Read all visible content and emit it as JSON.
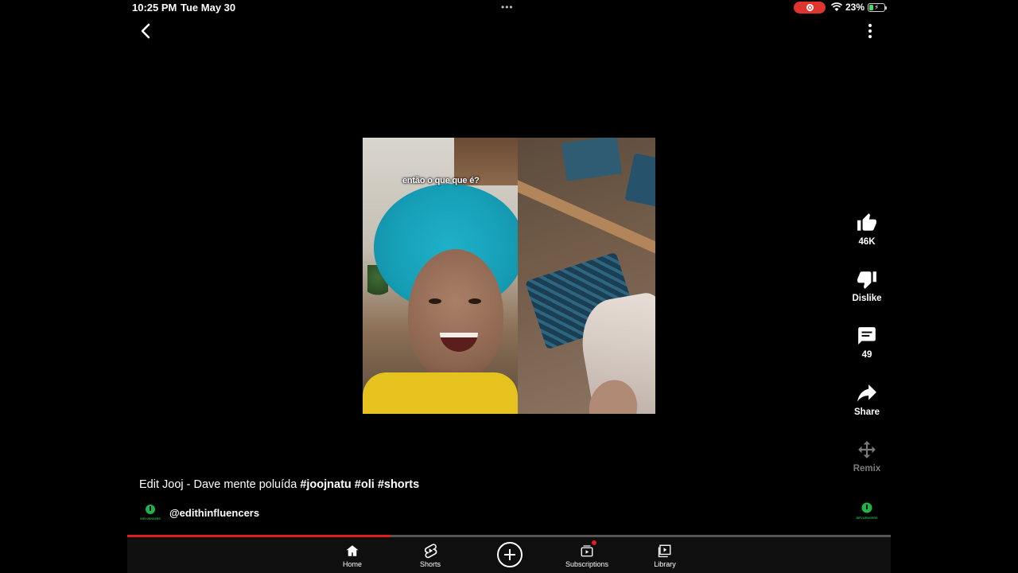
{
  "status_bar": {
    "time": "10:25 PM",
    "date": "Tue May 30",
    "dots": "•••",
    "battery_percent": "23%",
    "recording_color": "#e0342f"
  },
  "video": {
    "overlay_caption": "então o que que é?",
    "progress_fraction": 0.345
  },
  "actions": {
    "like_count": "46K",
    "dislike_label": "Dislike",
    "comment_count": "49",
    "share_label": "Share",
    "remix_label": "Remix"
  },
  "meta": {
    "title_prefix": "Edit Jooj - Dave mente poluída",
    "hashtags": [
      "#joojnatu",
      "#oli",
      "#shorts"
    ],
    "channel_handle": "@edithinfluencers",
    "avatar_text": "INFLUENCERS"
  },
  "nav": {
    "items": [
      {
        "label": "Home",
        "icon": "home-icon"
      },
      {
        "label": "Shorts",
        "icon": "shorts-icon"
      },
      {
        "label": "Subscriptions",
        "icon": "subscriptions-icon"
      },
      {
        "label": "Library",
        "icon": "library-icon"
      }
    ],
    "create_icon": "plus-icon"
  },
  "colors": {
    "background": "#000000",
    "progress_played": "#e01e1e",
    "avatar_green": "#1fb34a",
    "disabled_text": "#7a7a7a"
  }
}
